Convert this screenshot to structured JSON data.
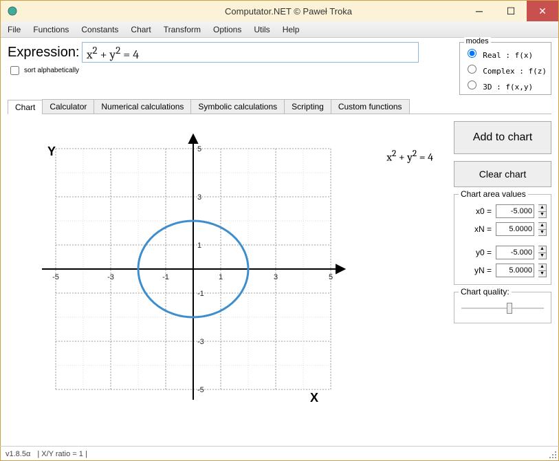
{
  "window": {
    "title": "Computator.NET © Paweł Troka"
  },
  "menu": [
    "File",
    "Functions",
    "Constants",
    "Chart",
    "Transform",
    "Options",
    "Utils",
    "Help"
  ],
  "expression": {
    "label": "Expression:",
    "value_html": "x<sup>2</sup> + y<sup>2</sup> = 4",
    "sort_label": "sort alphabetically",
    "sort_checked": false
  },
  "modes": {
    "legend": "modes",
    "options": [
      {
        "label": "Real : f(x)",
        "checked": true
      },
      {
        "label": "Complex : f(z)",
        "checked": false
      },
      {
        "label": "3D : f(x,y)",
        "checked": false
      }
    ]
  },
  "tabs": [
    "Chart",
    "Calculator",
    "Numerical calculations",
    "Symbolic calculations",
    "Scripting",
    "Custom functions"
  ],
  "active_tab": 0,
  "chart_overlay_equation_html": "x<sup>2</sup> + y<sup>2</sup> = 4",
  "buttons": {
    "add": "Add to chart",
    "clear": "Clear chart"
  },
  "chart_area": {
    "legend": "Chart area values",
    "x0_label": "x0 =",
    "x0": "-5.000",
    "xN_label": "xN =",
    "xN": "5.0000",
    "y0_label": "y0 =",
    "y0": "-5.000",
    "yN_label": "yN =",
    "yN": "5.0000"
  },
  "chart_quality": {
    "legend": "Chart quality:"
  },
  "status": {
    "version": "v1.8.5α",
    "ratio": "| X/Y ratio = 1 |"
  },
  "chart_data": {
    "type": "scatter",
    "title": "",
    "xlabel": "X",
    "ylabel": "Y",
    "xlim": [
      -5,
      5
    ],
    "ylim": [
      -5,
      5
    ],
    "xticks": [
      -5,
      -3,
      -1,
      1,
      3,
      5
    ],
    "yticks": [
      -5,
      -3,
      -1,
      1,
      3,
      5
    ],
    "series": [
      {
        "name": "x^2 + y^2 = 4",
        "shape": "circle",
        "cx": 0,
        "cy": 0,
        "r": 2,
        "color": "#3d8ecf"
      }
    ]
  }
}
